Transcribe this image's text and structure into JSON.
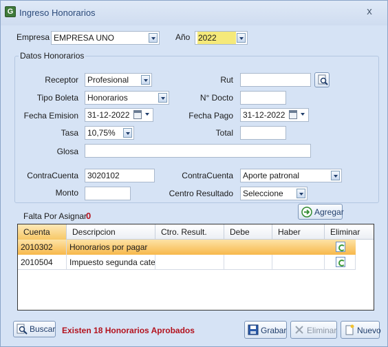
{
  "window": {
    "title": "Ingreso Honorarios",
    "close_glyph": "x"
  },
  "header": {
    "empresa_label": "Empresa",
    "empresa_value": "EMPRESA UNO",
    "anio_label": "Año",
    "anio_value": "2022"
  },
  "group": {
    "title": "Datos Honorarios"
  },
  "form": {
    "receptor_label": "Receptor",
    "receptor_value": "Profesional",
    "rut_label": "Rut",
    "rut_value": "",
    "tipo_boleta_label": "Tipo Boleta",
    "tipo_boleta_value": "Honorarios",
    "n_docto_label": "N° Docto",
    "n_docto_value": "",
    "fecha_emision_label": "Fecha Emision",
    "fecha_emision_value": "31-12-2022",
    "fecha_pago_label": "Fecha Pago",
    "fecha_pago_value": "31-12-2022",
    "tasa_label": "Tasa",
    "tasa_value": "10,75%",
    "total_label": "Total",
    "total_value": "",
    "glosa_label": "Glosa",
    "glosa_value": "",
    "contracuenta1_label": "ContraCuenta",
    "contracuenta1_value": "3020102",
    "contracuenta2_label": "ContraCuenta",
    "contracuenta2_value": "Aporte patronal",
    "monto_label": "Monto",
    "monto_value": "",
    "centro_label": "Centro Resultado",
    "centro_value": "Seleccione"
  },
  "falta": {
    "label": "Falta Por Asignar",
    "value": "0"
  },
  "agregar_label": "Agregar",
  "grid": {
    "columns": [
      "Cuenta",
      "Descripcion",
      "Ctro. Result.",
      "Debe",
      "Haber",
      "Eliminar"
    ],
    "rows": [
      {
        "cuenta": "2010302",
        "descripcion": "Honorarios por pagar",
        "ctro": "",
        "debe": "",
        "haber": ""
      },
      {
        "cuenta": "2010504",
        "descripcion": "Impuesto segunda cate...",
        "ctro": "",
        "debe": "",
        "haber": ""
      }
    ]
  },
  "footer": {
    "buscar_label": "Buscar",
    "status_text": "Existen 18 Honorarios Aprobados",
    "grabar_label": "Grabar",
    "eliminar_label": "Eliminar",
    "nuevo_label": "Nuevo"
  },
  "icons": {
    "app": "app-icon",
    "search": "search-icon",
    "add": "arrow-right-circle-icon",
    "save": "floppy-disk-icon",
    "delete": "x-icon",
    "new": "new-document-icon",
    "row_delete": "refresh-icon",
    "calendar": "calendar-icon",
    "dropdown": "chevron-down-icon"
  },
  "colors": {
    "selected_row": "#f7b84b",
    "status_red": "#b3121d",
    "year_highlight": "#f5e97a"
  }
}
